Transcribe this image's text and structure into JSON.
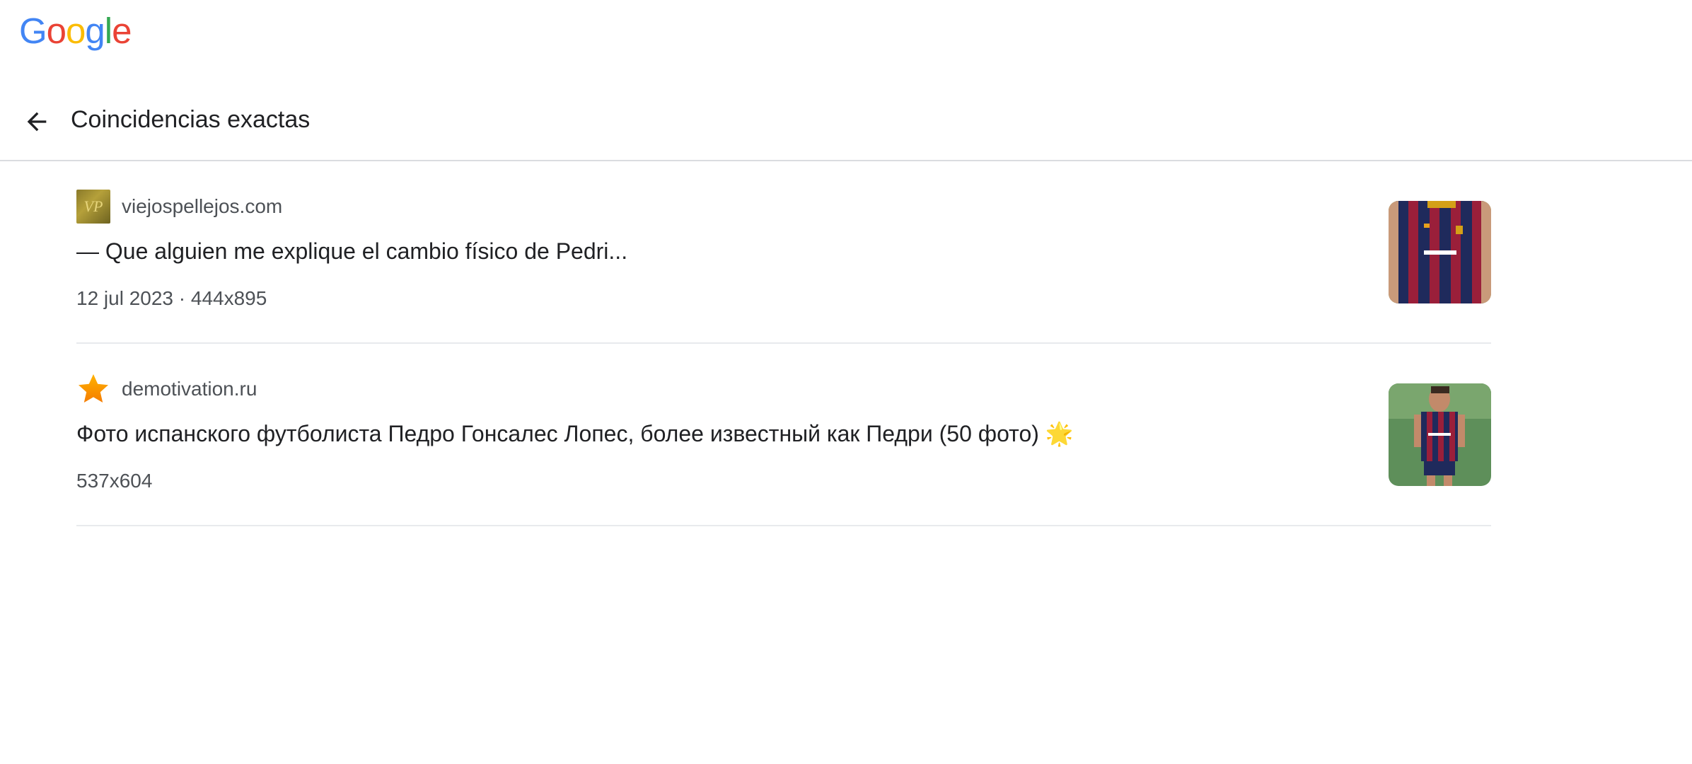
{
  "app": {
    "logo_letters": [
      {
        "ch": "G",
        "color": "#4285F4"
      },
      {
        "ch": "o",
        "color": "#EA4335"
      },
      {
        "ch": "o",
        "color": "#FBBC05"
      },
      {
        "ch": "g",
        "color": "#4285F4"
      },
      {
        "ch": "l",
        "color": "#34A853"
      },
      {
        "ch": "e",
        "color": "#EA4335"
      }
    ]
  },
  "header": {
    "back_icon": "arrow-left-icon",
    "title": "Coincidencias exactas"
  },
  "results": [
    {
      "favicon": "vp-site-favicon",
      "favicon_text": "VP",
      "site": "viejospellejos.com",
      "title": "— Que alguien me explique el cambio físico de Pedri...",
      "meta": "12 jul 2023 · 444x895"
    },
    {
      "favicon": "star-favicon",
      "site": "demotivation.ru",
      "title": "Фото испанского футболиста Педро Гонсалес Лопес, более известный как Педри (50 фото) 🌟",
      "meta": "537x604"
    }
  ]
}
